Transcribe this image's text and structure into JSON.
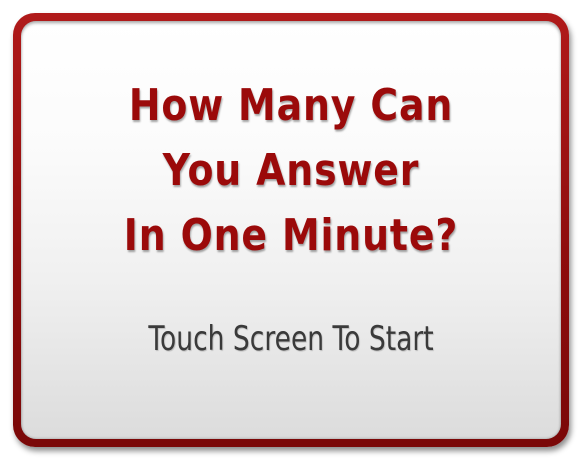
{
  "screen": {
    "headline_lines": [
      "How Many Can",
      "You Answer",
      "In One Minute?"
    ],
    "prompt": "Touch Screen To Start"
  },
  "colors": {
    "frame": "#9b0f0f",
    "headline": "#9b0a0a",
    "prompt": "#3a3a3a",
    "panel_top": "#ffffff",
    "panel_bottom": "#dcdcdc"
  }
}
